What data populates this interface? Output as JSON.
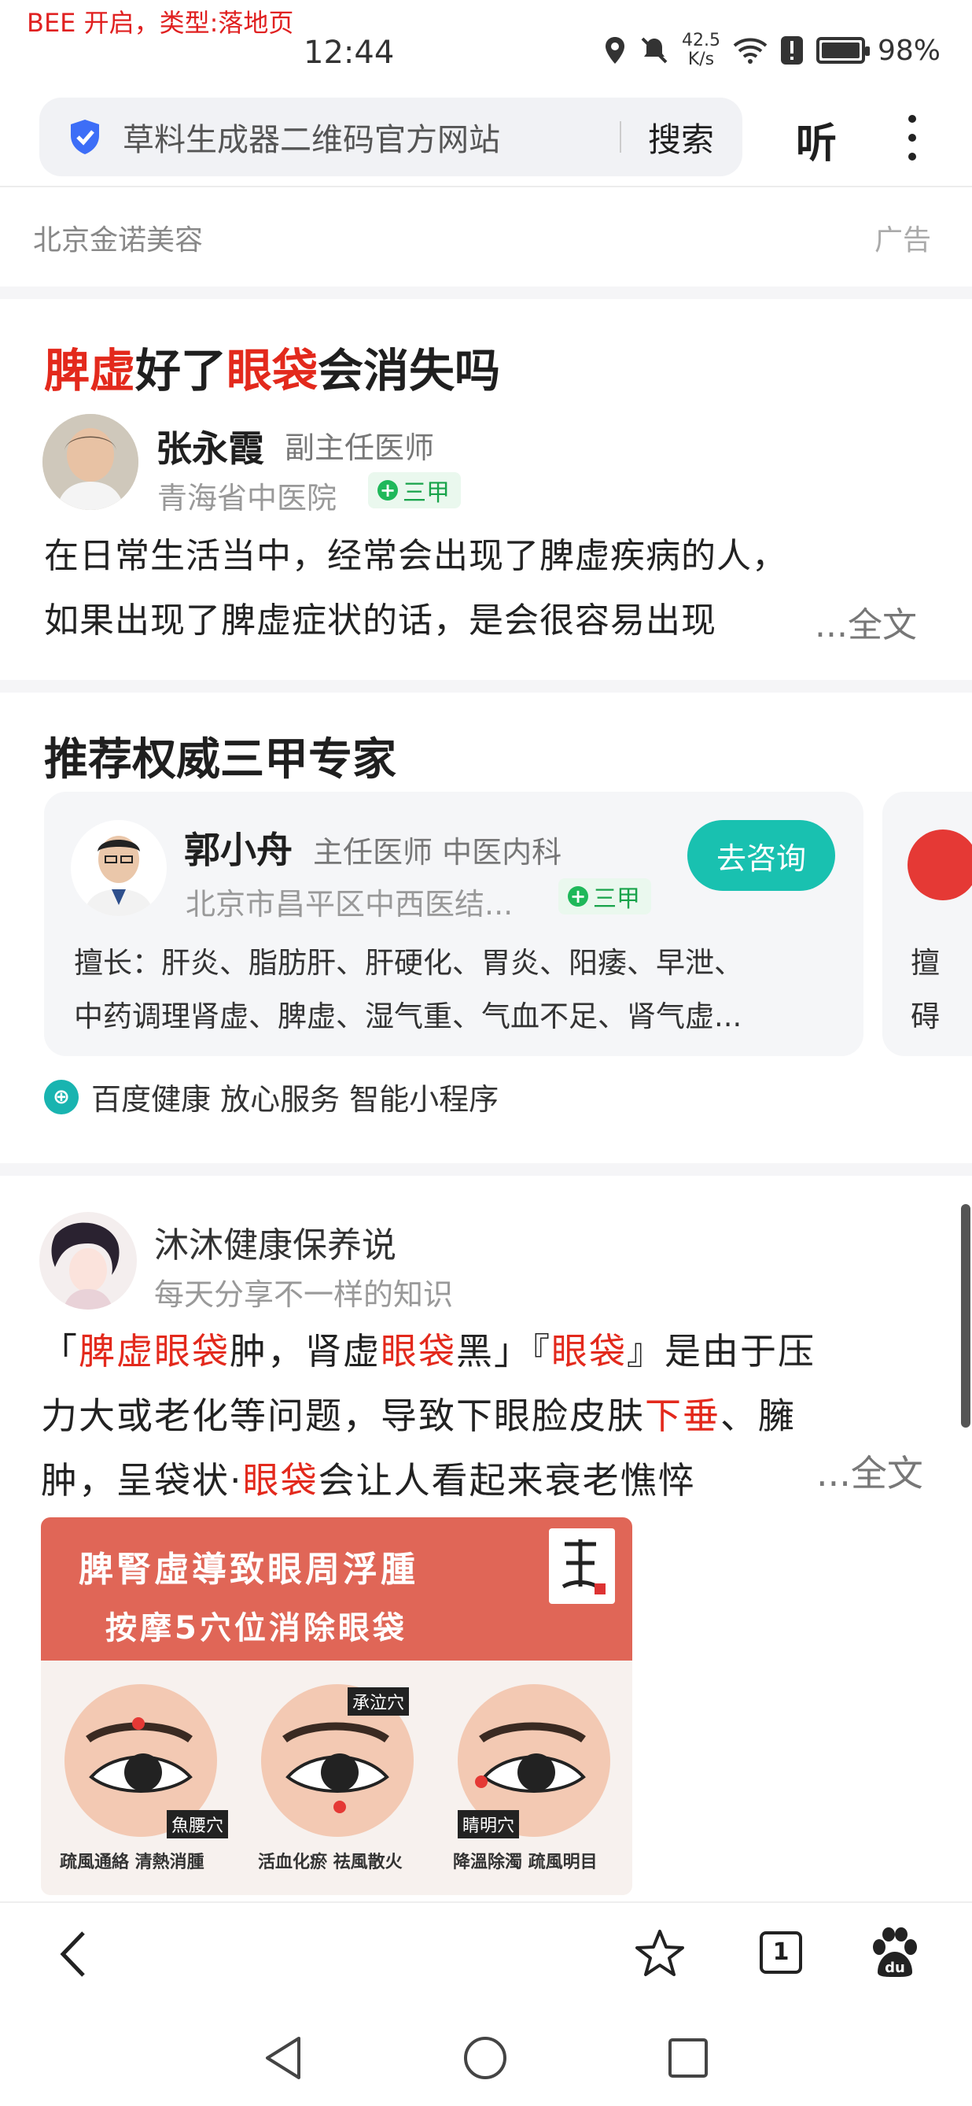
{
  "debug": "BEE 开启，类型:落地页",
  "status": {
    "time": "12:44",
    "speed": "42.5",
    "speed_unit": "K/s",
    "battery": "98%"
  },
  "search": {
    "query": "草料生成器二维码官方网站",
    "button": "搜索",
    "listen": "听"
  },
  "ad": {
    "advertiser": "北京金诺美容",
    "label": "广告"
  },
  "article": {
    "title_parts": [
      "脾虚",
      "好了",
      "眼袋",
      "会消失吗"
    ],
    "doctor": {
      "name": "张永霞",
      "title": "副主任医师",
      "hospital": "青海省中医院",
      "badge": "三甲"
    },
    "line1": "在日常生活当中，经常会出现了脾虚疾病的人，",
    "line2": "如果出现了脾虚症状的话，是会很容易出现",
    "more": "...全文"
  },
  "experts": {
    "section_title": "推荐权威三甲专家",
    "card": {
      "name": "郭小舟",
      "title": "主任医师  中医内科",
      "hospital": "北京市昌平区中西医结...",
      "badge": "三甲",
      "consult": "去咨询",
      "skills_line1": "擅长：肝炎、脂肪肝、肝硬化、胃炎、阳痿、早泄、",
      "skills_line2": "中药调理肾虚、脾虚、湿气重、气血不足、肾气虚..."
    },
    "card2_line1": "擅",
    "card2_line2": "碍",
    "footer": "百度健康 放心服务 智能小程序"
  },
  "post": {
    "author": "沐沐健康保养说",
    "author_sub": "每天分享不一样的知识",
    "l1": [
      "「",
      "脾虚眼袋",
      "肿，肾虚",
      "眼袋",
      "黑」『",
      "眼袋",
      "』是由于压"
    ],
    "l2": [
      "力大或老化等问题，导致下眼脸皮肤",
      "下垂",
      "、臃"
    ],
    "l3": [
      "肿，呈袋状·",
      "眼袋",
      "会让人看起来衰老憔悴"
    ],
    "more": "...全文",
    "image": {
      "title1": "脾腎虛導致眼周浮腫",
      "title2": "按摩5穴位消除眼袋",
      "labels": [
        "魚腰穴",
        "承泣穴",
        "睛明穴"
      ],
      "captions": [
        "疏風通絡 清熱消腫",
        "活血化瘀 祛風散火",
        "降溫除濁 疏風明目"
      ]
    }
  },
  "tabs_count": "1"
}
